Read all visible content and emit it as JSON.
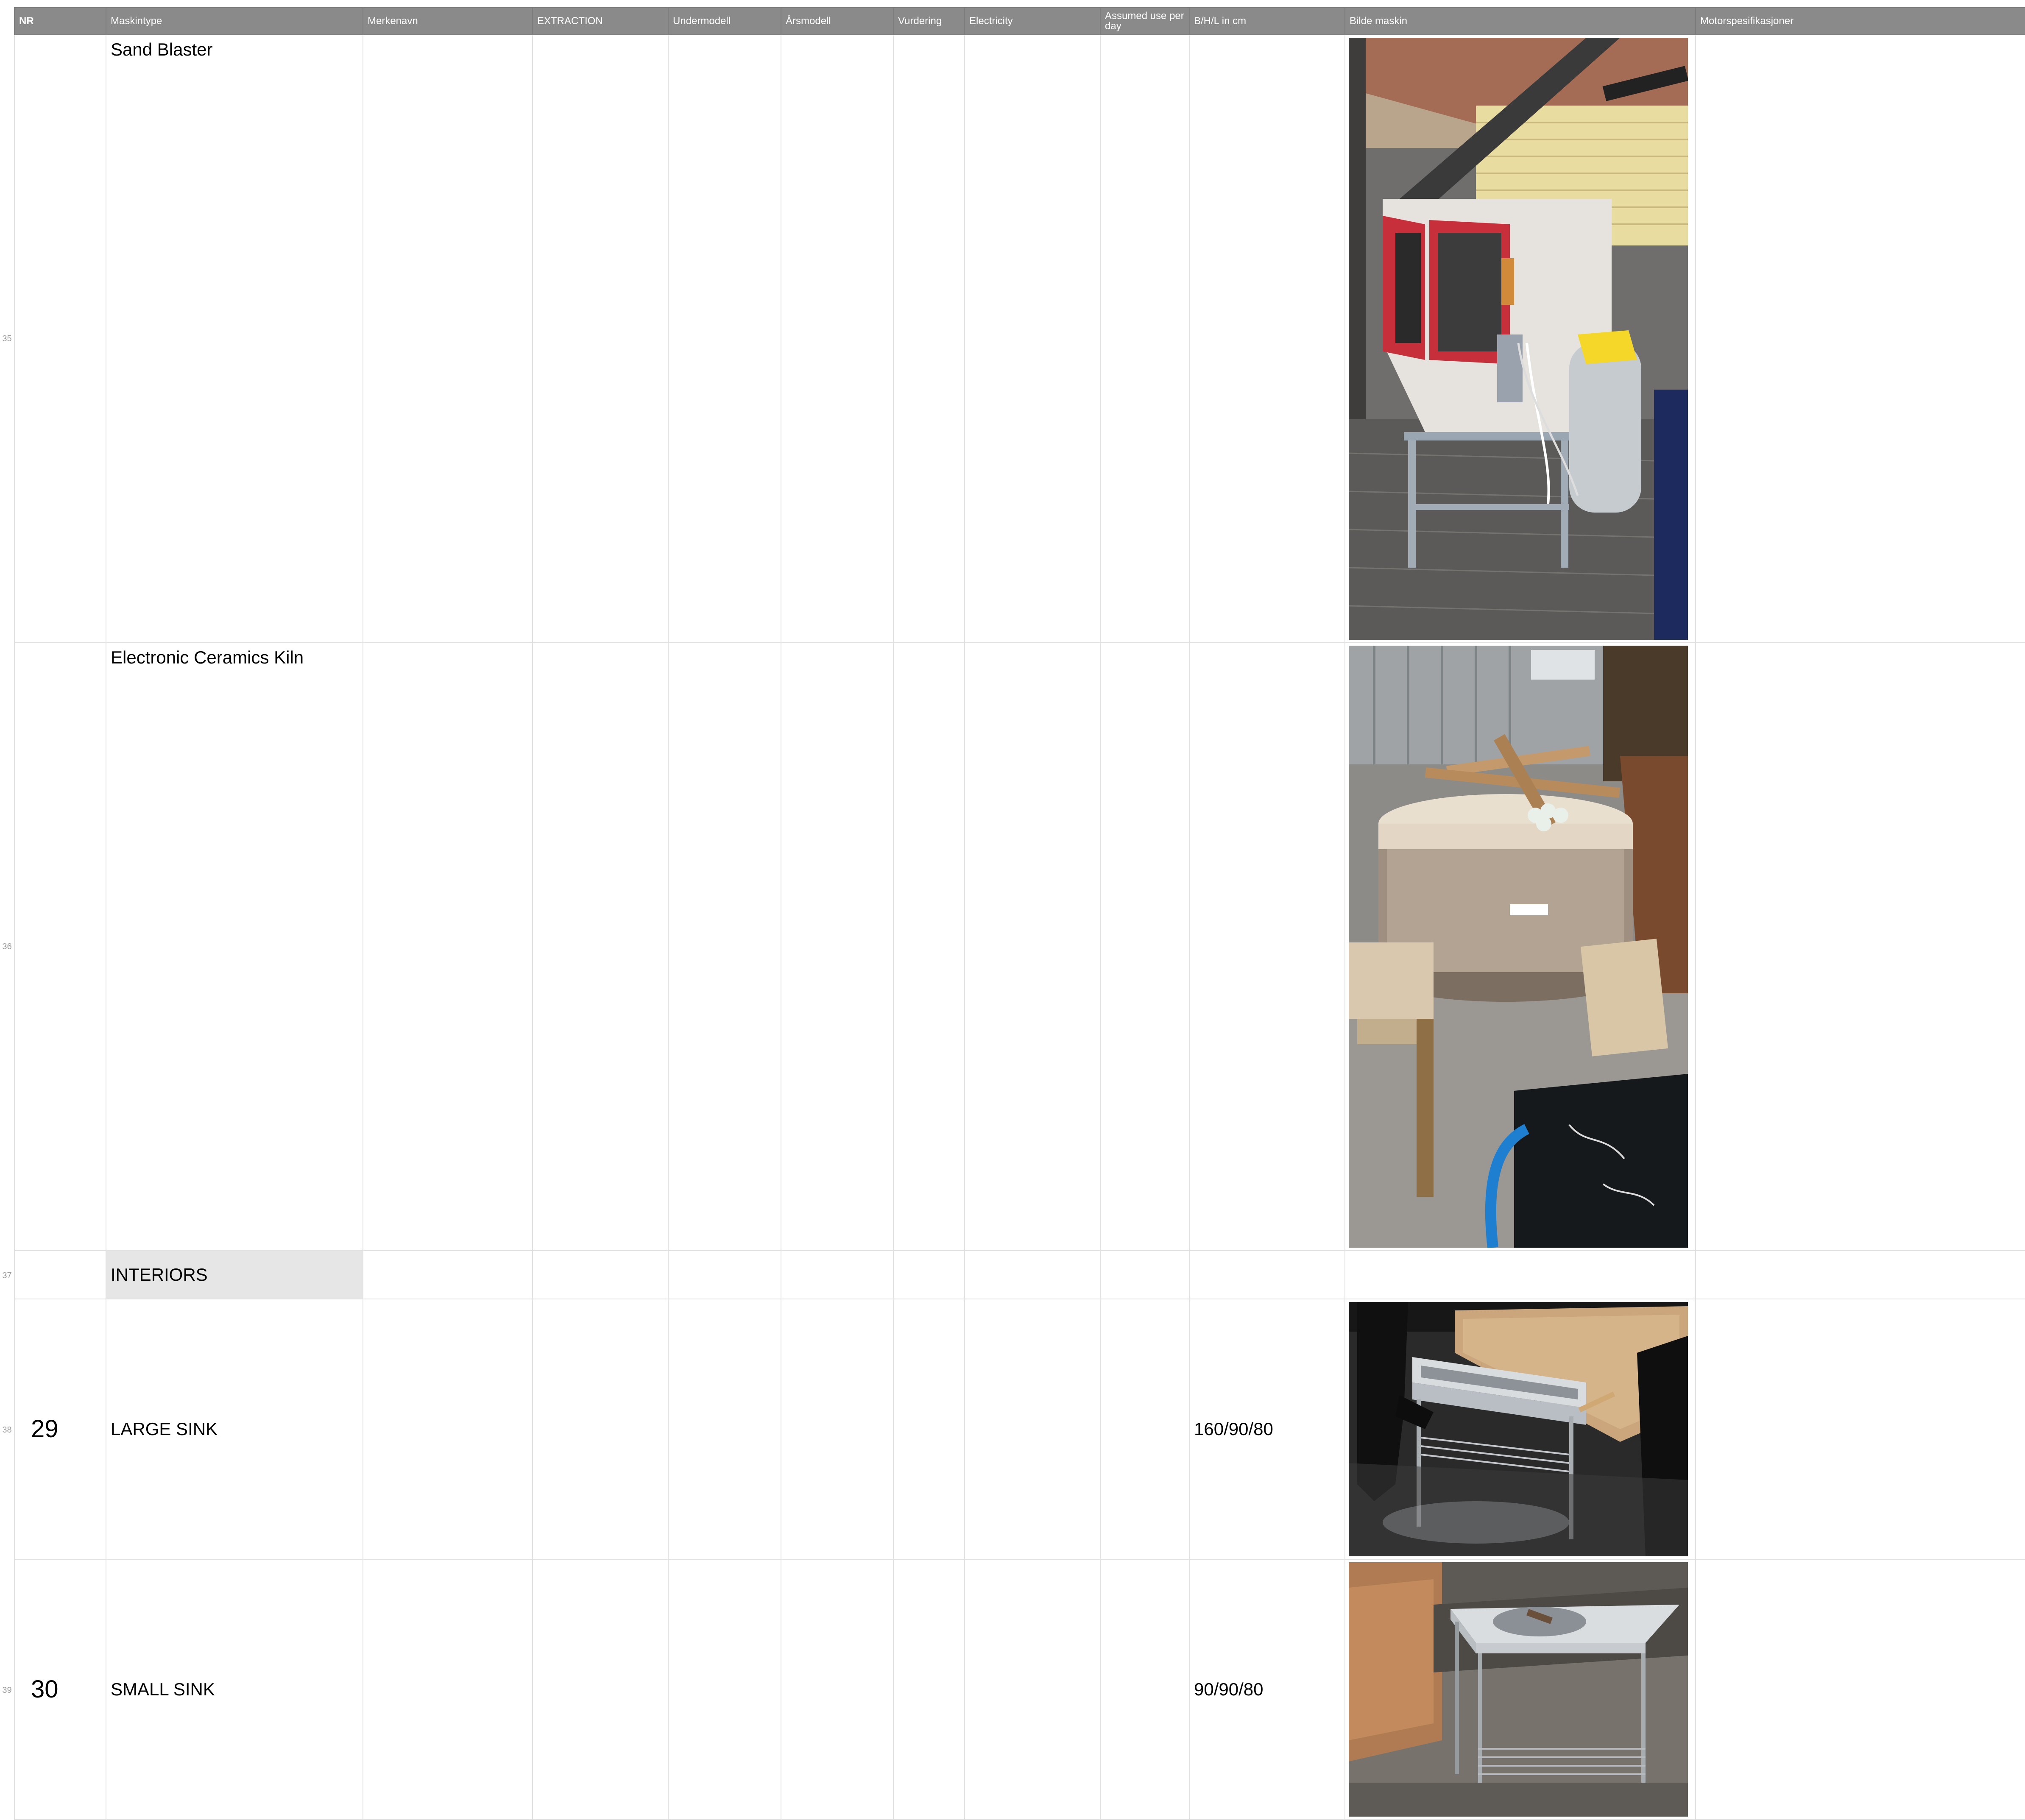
{
  "sheet": {
    "headers": {
      "nr": "NR",
      "maskintype": "Maskintype",
      "merkenavn": "Merkenavn",
      "extraction": "EXTRACTION",
      "undermodell": "Undermodell",
      "arsmodell": "Årsmodell",
      "vurdering": "Vurdering",
      "electricity": "Electricity",
      "assumed_use": "Assumed use per day",
      "bhl": "B/H/L in cm",
      "bilde": "Bilde maskin",
      "motor": "Motorspesifikasjoner"
    },
    "row_numbers": [
      "35",
      "36",
      "37",
      "38",
      "39"
    ],
    "rows": [
      {
        "nr": "",
        "maskintype": "Sand Blaster",
        "bhl": "",
        "photo_icon": "sand-blaster-photo"
      },
      {
        "nr": "",
        "maskintype": "Electronic Ceramics Kiln",
        "bhl": "",
        "photo_icon": "ceramics-kiln-photo"
      },
      {
        "section": "INTERIORS"
      },
      {
        "nr": "29",
        "maskintype": "LARGE SINK",
        "bhl": "160/90/80",
        "photo_icon": "large-sink-photo"
      },
      {
        "nr": "30",
        "maskintype": "SMALL SINK",
        "bhl": "90/90/80",
        "photo_icon": "small-sink-photo"
      }
    ]
  },
  "colors": {
    "header_bg": "#8a8a8a",
    "header_text": "#ffffff",
    "grid_line": "#e1e1e1",
    "section_bg": "#e6e6e6"
  }
}
